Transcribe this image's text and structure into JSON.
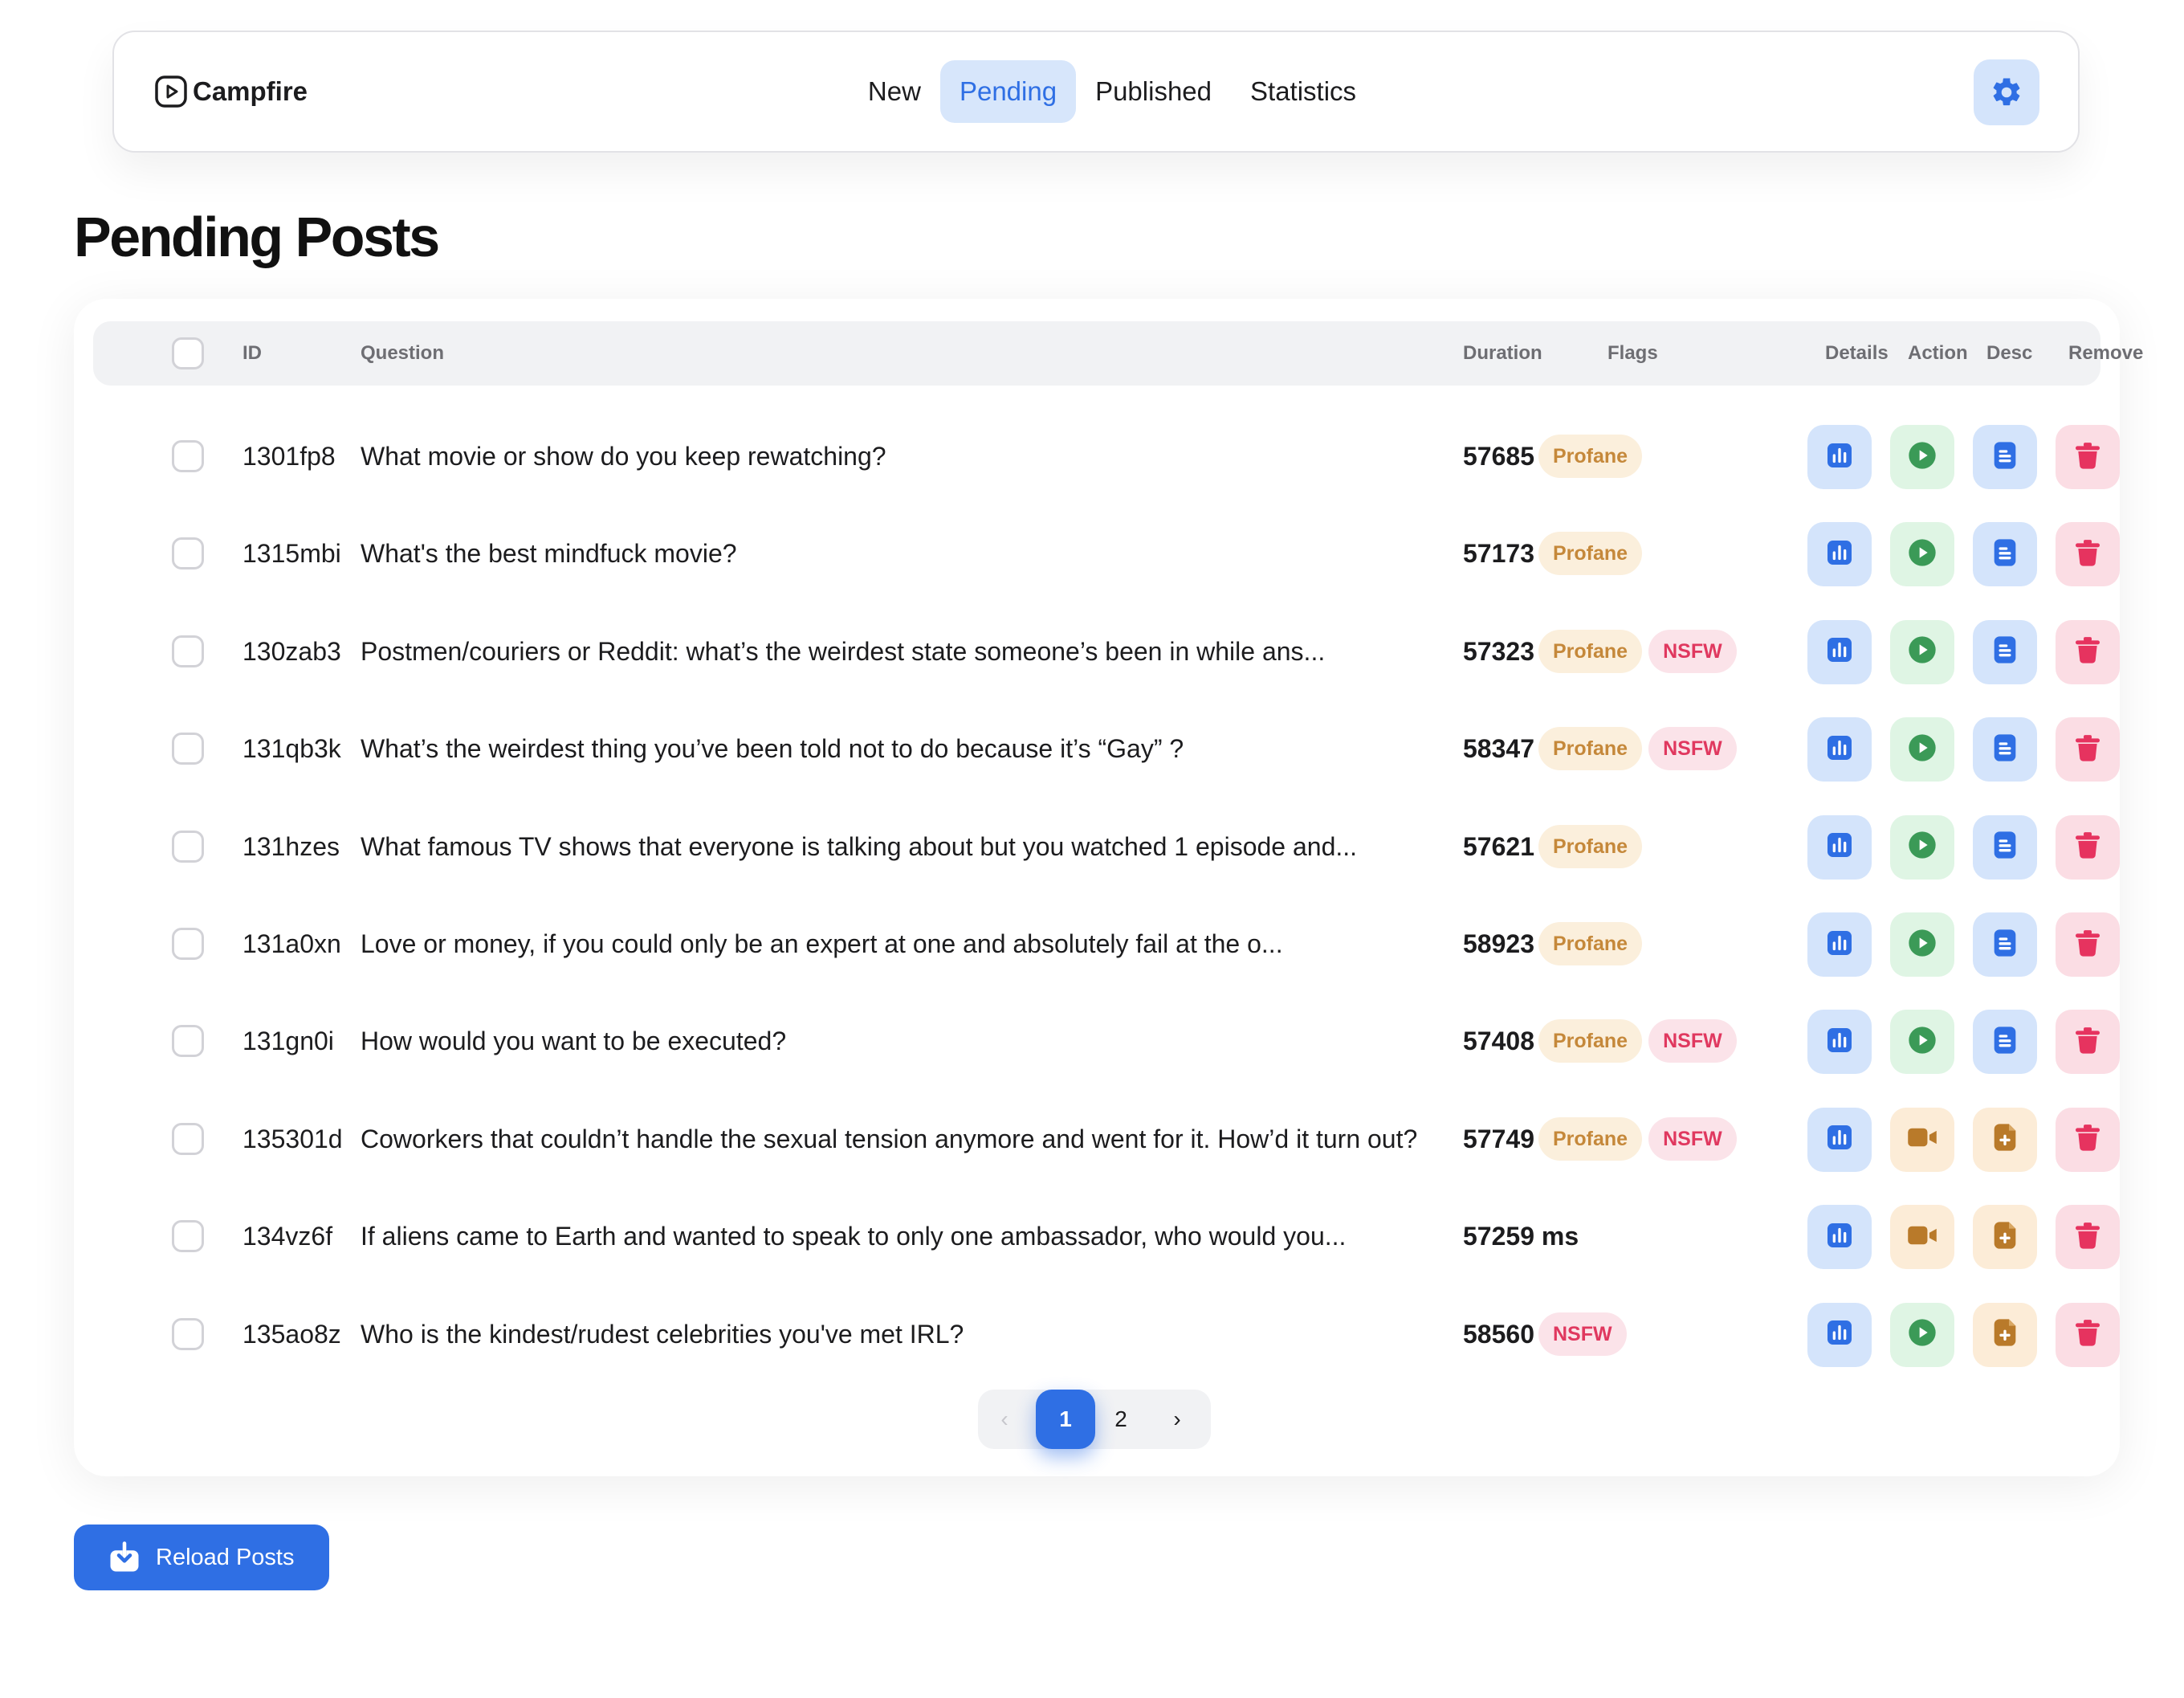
{
  "navbar": {
    "brand": "Campfire",
    "tabs": [
      {
        "label": "New",
        "active": false
      },
      {
        "label": "Pending",
        "active": true
      },
      {
        "label": "Published",
        "active": false
      },
      {
        "label": "Statistics",
        "active": false
      }
    ],
    "settings_icon": "gear-icon"
  },
  "page": {
    "title": "Pending Posts"
  },
  "table": {
    "headers": {
      "id": "ID",
      "question": "Question",
      "duration": "Duration",
      "flags": "Flags",
      "details": "Details",
      "action": "Action",
      "desc": "Desc",
      "remove": "Remove"
    },
    "rows": [
      {
        "id": "1301fp8",
        "question": "What movie or show do you keep rewatching?",
        "duration": "57685 ms",
        "flags": [
          "Profane"
        ],
        "action": "play",
        "desc": "doc"
      },
      {
        "id": "1315mbi",
        "question": "What's the best mindfuck movie?",
        "duration": "57173 ms",
        "flags": [
          "Profane"
        ],
        "action": "play",
        "desc": "doc"
      },
      {
        "id": "130zab3",
        "question": "Postmen/couriers or Reddit: what’s the weirdest state someone’s been in while ans...",
        "duration": "57323 ms",
        "flags": [
          "Profane",
          "NSFW"
        ],
        "action": "play",
        "desc": "doc"
      },
      {
        "id": "131qb3k",
        "question": "What’s the weirdest thing you’ve been told not to do because it’s “Gay” ?",
        "duration": "58347 ms",
        "flags": [
          "Profane",
          "NSFW"
        ],
        "action": "play",
        "desc": "doc"
      },
      {
        "id": "131hzes",
        "question": "What famous TV shows that everyone is talking about but you watched 1 episode and...",
        "duration": "57621 ms",
        "flags": [
          "Profane"
        ],
        "action": "play",
        "desc": "doc"
      },
      {
        "id": "131a0xn",
        "question": "Love or money, if you could only be an expert at one and absolutely fail at the o...",
        "duration": "58923 ms",
        "flags": [
          "Profane"
        ],
        "action": "play",
        "desc": "doc"
      },
      {
        "id": "131gn0i",
        "question": "How would you want to be executed?",
        "duration": "57408 ms",
        "flags": [
          "Profane",
          "NSFW"
        ],
        "action": "play",
        "desc": "doc"
      },
      {
        "id": "135301d",
        "question": "Coworkers that couldn’t handle the sexual tension anymore and went for it. How’d it turn out?",
        "duration": "57749 ms",
        "flags": [
          "Profane",
          "NSFW"
        ],
        "action": "video",
        "desc": "file-add"
      },
      {
        "id": "134vz6f",
        "question": "If aliens came to Earth and wanted to speak to only one ambassador, who would you...",
        "duration": "57259 ms",
        "flags": [],
        "action": "video",
        "desc": "file-add"
      },
      {
        "id": "135ao8z",
        "question": "Who is the kindest/rudest celebrities you've met IRL?",
        "duration": "58560 ms",
        "flags": [
          "NSFW"
        ],
        "action": "play",
        "desc": "file-add"
      }
    ]
  },
  "pagination": {
    "prev": "‹",
    "current": "1",
    "page2": "2",
    "next": "›"
  },
  "reload": {
    "label": "Reload Posts"
  },
  "colors": {
    "accent": "#2f6fe4",
    "profane_bg": "#fbefdc",
    "profane_text": "#c5883a",
    "nsfw_bg": "#fbe3e9",
    "nsfw_text": "#e0385f",
    "play_green": "#3b9a57",
    "orange_icon": "#b97a2a",
    "trash_red": "#e6335f"
  }
}
